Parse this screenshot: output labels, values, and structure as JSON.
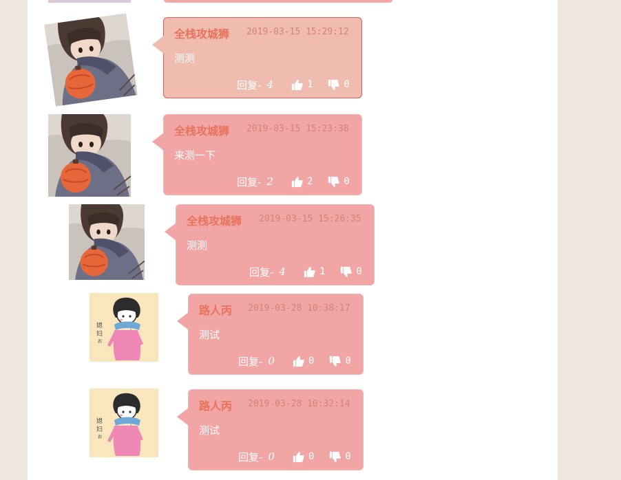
{
  "comments": [
    {
      "name": "全栈攻城狮",
      "time": "2019-03-15 15:29:12",
      "content": "测测",
      "reply_label": "回复-",
      "reply_count": "4",
      "likes": "1",
      "dislikes": "0",
      "avatar": "girl-with-lantern-avatar",
      "active": true
    },
    {
      "name": "全栈攻城狮",
      "time": "2019-03-15 15:23:38",
      "content": "来测一下",
      "reply_label": "回复-",
      "reply_count": "2",
      "likes": "2",
      "dislikes": "0",
      "avatar": "girl-with-lantern-avatar",
      "active": false
    },
    {
      "name": "全栈攻城狮",
      "time": "2019-03-15 15:26:35",
      "content": "测测",
      "reply_label": "回复-",
      "reply_count": "4",
      "likes": "1",
      "dislikes": "0",
      "avatar": "girl-with-lantern-avatar",
      "active": false
    },
    {
      "name": "路人丙",
      "time": "2019-03-28 10:38:17",
      "content": "测试",
      "reply_label": "回复-",
      "reply_count": "0",
      "likes": "0",
      "dislikes": "0",
      "avatar": "cartoon-scarf-avatar",
      "active": false
    },
    {
      "name": "路人丙",
      "time": "2019-03-28 10:32:14",
      "content": "测试",
      "reply_label": "回复-",
      "reply_count": "0",
      "likes": "0",
      "dislikes": "0",
      "avatar": "cartoon-scarf-avatar",
      "active": false
    }
  ],
  "colors": {
    "page_bg": "#efe8df",
    "bubble_bg": "#f2a5a5",
    "bubble_active_bg": "#f0bcb0",
    "bubble_active_border": "#e85a4f",
    "name_color": "#e9725b",
    "time_color": "#d4807a"
  },
  "icons": {
    "like": "thumbs-up-icon",
    "dislike": "thumbs-down-icon"
  }
}
